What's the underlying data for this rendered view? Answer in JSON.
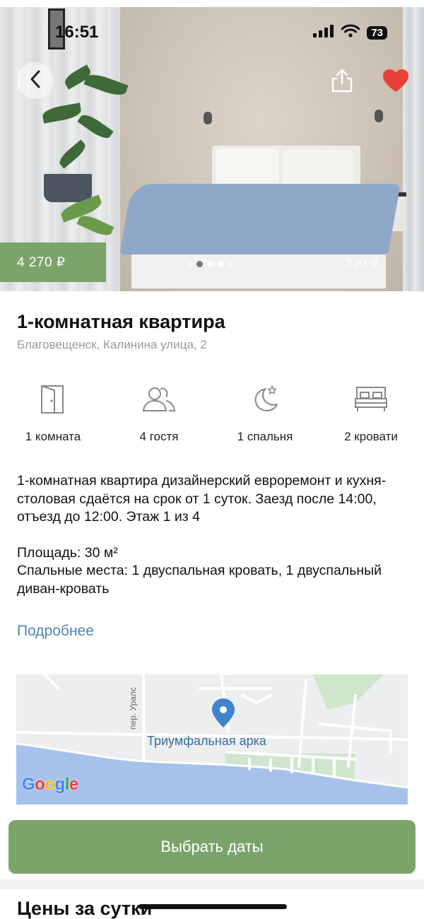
{
  "status_bar": {
    "time": "16:51",
    "battery": "73"
  },
  "photo": {
    "price": "4 270 ₽",
    "counter": "3 из 9",
    "slide_count": 5,
    "active_slide": 3
  },
  "listing": {
    "title": "1-комнатная квартира",
    "address": "Благовещенск, Калинина улица, 2"
  },
  "features": [
    {
      "icon": "door-icon",
      "label": "1 комната"
    },
    {
      "icon": "guests-icon",
      "label": "4 гостя"
    },
    {
      "icon": "moon-icon",
      "label": "1 спальня"
    },
    {
      "icon": "bed-icon",
      "label": "2 кровати"
    }
  ],
  "description": {
    "paragraph1": "1-комнатная квартира дизайнерский евроремонт и кухня-столовая сдаётся на срок от 1 суток. Заезд после 14:00, отъезд до 12:00. Этаж 1 из 4",
    "area": "Площадь: 30 м²",
    "beds": "Спальные места: 1 двуспальная кровать, 1 двуспальный диван-кровать"
  },
  "more_link": "Подробнее",
  "map": {
    "place_label": "Триумфальная арка",
    "street_label": "пер. Уралс",
    "logo": "Google"
  },
  "cta_button": "Выбрать даты",
  "next_section_title": "Цены за сутки",
  "colors": {
    "accent_green": "#7ba46b",
    "link_blue": "#4d86b8",
    "heart_red": "#e8413a",
    "water": "#a6c2ec"
  }
}
